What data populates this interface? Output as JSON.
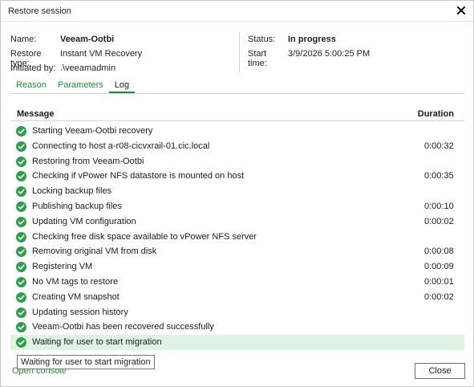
{
  "window": {
    "title": "Restore session"
  },
  "info": {
    "name_label": "Name:",
    "name_value": "Veeam-Ootbi",
    "restore_type_label": "Restore type:",
    "restore_type_value": "Instant VM Recovery",
    "initiated_by_label": "Initiated by:",
    "initiated_by_value": ".\\veeamadmin",
    "status_label": "Status:",
    "status_value": "In progress",
    "start_time_label": "Start time:",
    "start_time_value": "3/9/2026 5:00:25 PM"
  },
  "tabs": [
    {
      "label": "Reason",
      "active": false
    },
    {
      "label": "Parameters",
      "active": false
    },
    {
      "label": "Log",
      "active": true
    }
  ],
  "log": {
    "columns": {
      "message": "Message",
      "duration": "Duration"
    },
    "rows": [
      {
        "message": "Starting Veeam-Ootbi recovery",
        "duration": ""
      },
      {
        "message": "Connecting to host a-r08-cicvxrail-01.cic.local",
        "duration": "0:00:32"
      },
      {
        "message": "Restoring from Veeam-Ootbi",
        "duration": ""
      },
      {
        "message": "Checking if vPower NFS datastore is mounted on host",
        "duration": "0:00:35"
      },
      {
        "message": "Locking backup files",
        "duration": ""
      },
      {
        "message": "Publishing backup files",
        "duration": "0:00:10"
      },
      {
        "message": "Updating VM configuration",
        "duration": "0:00:02"
      },
      {
        "message": "Checking free disk space available to vPower NFS server",
        "duration": ""
      },
      {
        "message": "Removing original VM from disk",
        "duration": "0:00:08"
      },
      {
        "message": "Registering VM",
        "duration": "0:00:09"
      },
      {
        "message": "No VM tags to restore",
        "duration": "0:00:01"
      },
      {
        "message": "Creating VM snapshot",
        "duration": "0:00:02"
      },
      {
        "message": "Updating session history",
        "duration": ""
      },
      {
        "message": "Veeam-Ootbi has been recovered successfully",
        "duration": ""
      },
      {
        "message": "Waiting for user to start migration",
        "duration": ""
      }
    ],
    "selected_index": 14
  },
  "tooltip": {
    "text": "Waiting for user to start migration"
  },
  "footer": {
    "open_console_label": "Open console",
    "close_label": "Close"
  },
  "colors": {
    "accent": "#1e8f3c",
    "selected_row": "#dff3e2",
    "ok_icon": "#2e9e4a"
  },
  "icons": {
    "row_status": "check-circle-icon",
    "window_close": "close-icon"
  }
}
